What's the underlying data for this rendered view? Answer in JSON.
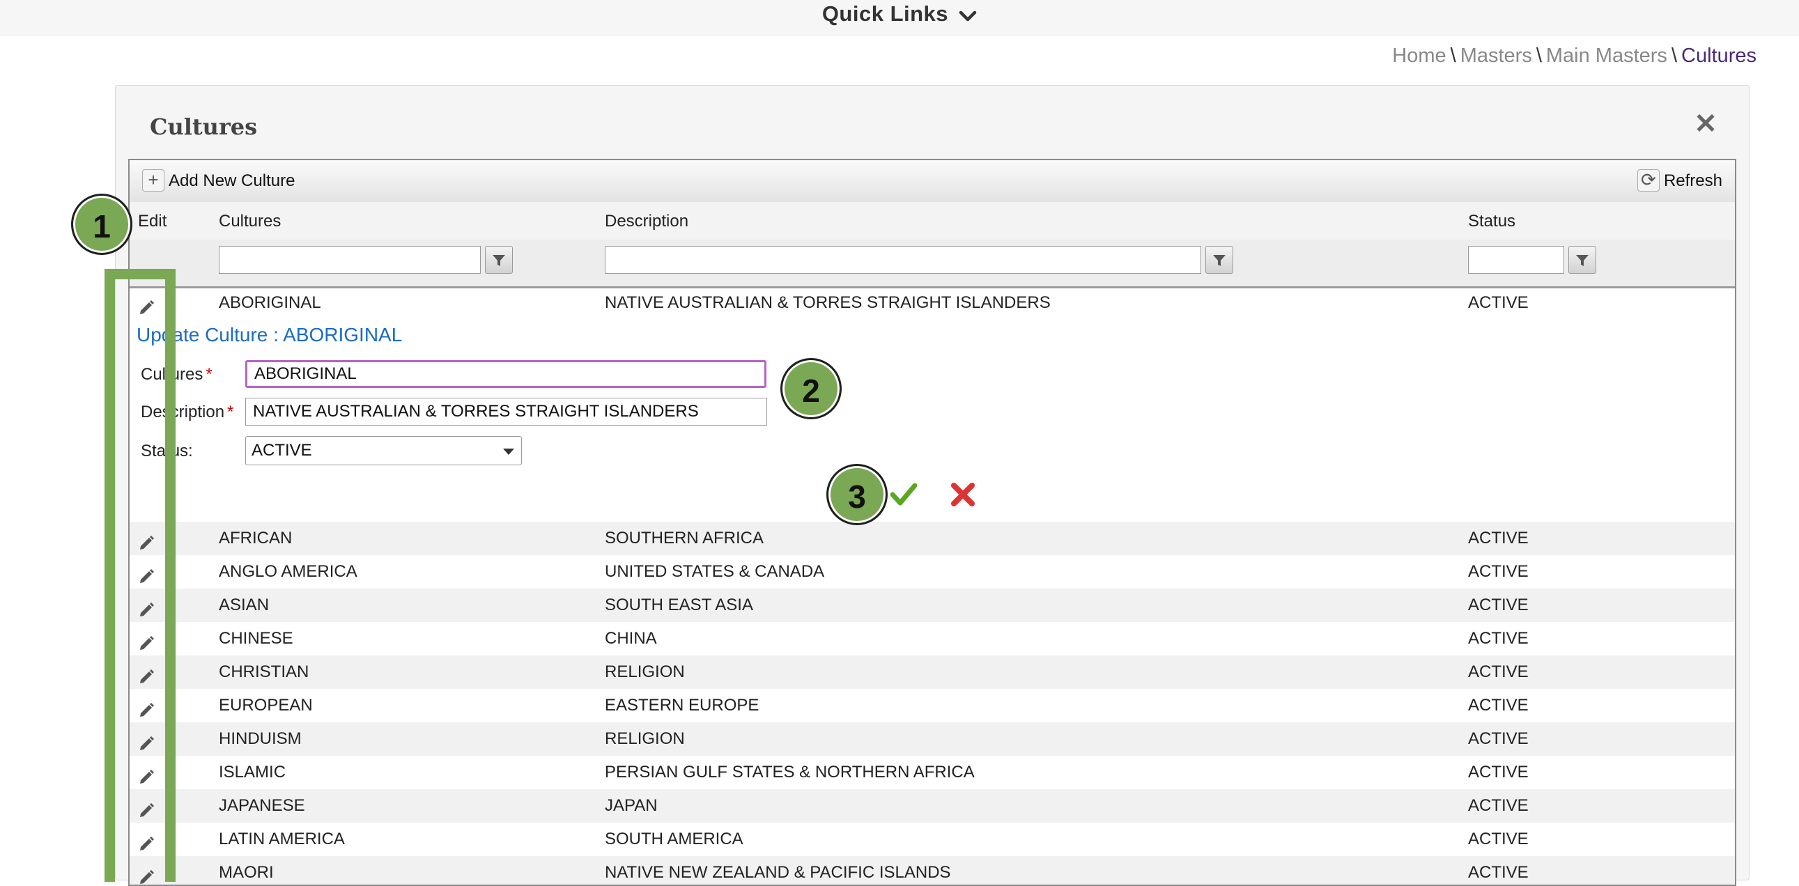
{
  "quick_links": {
    "label": "Quick Links"
  },
  "breadcrumb": {
    "home": "Home",
    "masters": "Masters",
    "main_masters": "Main Masters",
    "current": "Cultures",
    "sep": "\\"
  },
  "panel": {
    "title": "Cultures",
    "close_glyph": "✕"
  },
  "toolbar": {
    "add_label": "Add New Culture",
    "add_glyph": "+",
    "refresh_label": "Refresh",
    "refresh_glyph": "⟳"
  },
  "columns": {
    "edit": "Edit",
    "cultures": "Cultures",
    "description": "Description",
    "status": "Status"
  },
  "editing_row": {
    "culture": "ABORIGINAL",
    "description": "NATIVE AUSTRALIAN & TORRES STRAIGHT ISLANDERS",
    "status": "ACTIVE"
  },
  "edit_form": {
    "title": "Update Culture : ABORIGINAL",
    "culture_label": "Cultures",
    "description_label": "Description",
    "status_label": "Status:",
    "required_mark": "*",
    "culture_value": "ABORIGINAL",
    "description_value": "NATIVE AUSTRALIAN & TORRES STRAIGHT ISLANDERS",
    "status_value": "ACTIVE"
  },
  "rows": [
    {
      "culture": "AFRICAN",
      "description": "SOUTHERN AFRICA",
      "status": "ACTIVE"
    },
    {
      "culture": "ANGLO AMERICA",
      "description": "UNITED STATES & CANADA",
      "status": "ACTIVE"
    },
    {
      "culture": "ASIAN",
      "description": "SOUTH EAST ASIA",
      "status": "ACTIVE"
    },
    {
      "culture": "CHINESE",
      "description": "CHINA",
      "status": "ACTIVE"
    },
    {
      "culture": "CHRISTIAN",
      "description": "RELIGION",
      "status": "ACTIVE"
    },
    {
      "culture": "EUROPEAN",
      "description": "EASTERN EUROPE",
      "status": "ACTIVE"
    },
    {
      "culture": "HINDUISM",
      "description": "RELIGION",
      "status": "ACTIVE"
    },
    {
      "culture": "ISLAMIC",
      "description": "PERSIAN GULF STATES & NORTHERN AFRICA",
      "status": "ACTIVE"
    },
    {
      "culture": "JAPANESE",
      "description": "JAPAN",
      "status": "ACTIVE"
    },
    {
      "culture": "LATIN AMERICA",
      "description": "SOUTH AMERICA",
      "status": "ACTIVE"
    },
    {
      "culture": "MAORI",
      "description": "NATIVE NEW ZEALAND & PACIFIC ISLANDS",
      "status": "ACTIVE"
    }
  ],
  "annotations": {
    "badge1": "1",
    "badge2": "2",
    "badge3": "3"
  },
  "colors": {
    "accent_green": "#7aa854",
    "link_blue": "#1a6bc4",
    "focus_purple": "#b763c7",
    "breadcrumb_current": "#4a2a7a"
  }
}
